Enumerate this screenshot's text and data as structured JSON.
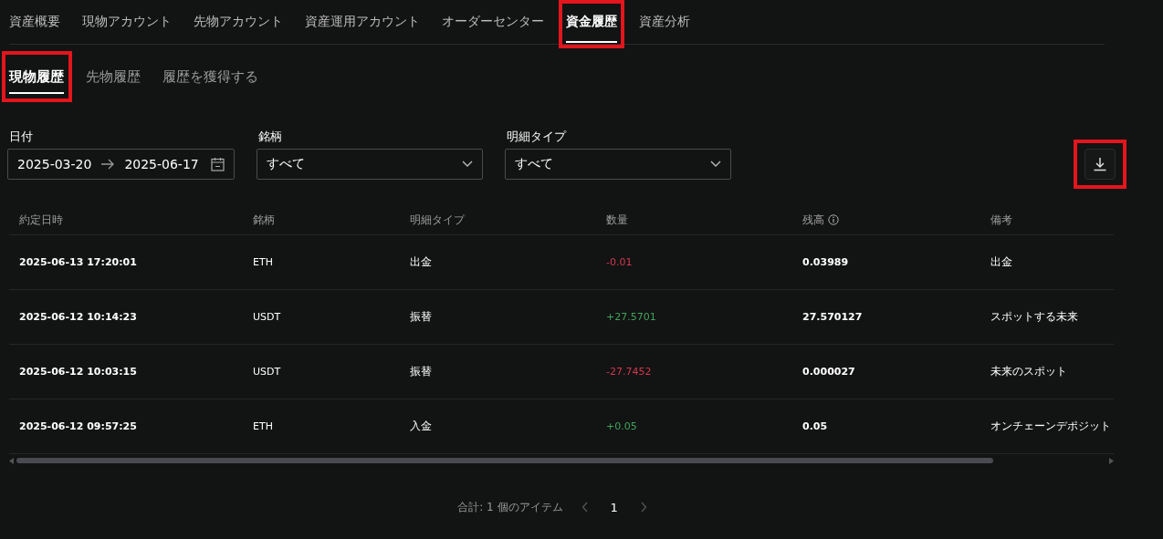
{
  "tabs": [
    {
      "label": "資産概要",
      "selected": false,
      "highlighted": false
    },
    {
      "label": "現物アカウント",
      "selected": false,
      "highlighted": false
    },
    {
      "label": "先物アカウント",
      "selected": false,
      "highlighted": false
    },
    {
      "label": "資産運用アカウント",
      "selected": false,
      "highlighted": false
    },
    {
      "label": "オーダーセンター",
      "selected": false,
      "highlighted": false
    },
    {
      "label": "資金履歴",
      "selected": true,
      "highlighted": true
    },
    {
      "label": "資産分析",
      "selected": false,
      "highlighted": false
    }
  ],
  "subtabs": [
    {
      "label": "現物履歴",
      "selected": true,
      "highlighted": true
    },
    {
      "label": "先物履歴",
      "selected": false,
      "highlighted": false
    },
    {
      "label": "履歴を獲得する",
      "selected": false,
      "highlighted": false
    }
  ],
  "filters": {
    "date": {
      "label": "日付",
      "start": "2025-03-20",
      "end": "2025-06-17"
    },
    "symbol": {
      "label": "銘柄",
      "value": "すべて"
    },
    "type": {
      "label": "明細タイプ",
      "value": "すべて"
    },
    "download_highlighted": true
  },
  "table": {
    "columns": [
      "約定日時",
      "銘柄",
      "明細タイプ",
      "数量",
      "残高",
      "備考"
    ],
    "rows": [
      {
        "time": "2025-06-13 17:20:01",
        "symbol": "ETH",
        "type": "出金",
        "amount": "-0.01",
        "kind": "debit",
        "balance": "0.03989",
        "note": "出金"
      },
      {
        "time": "2025-06-12 10:14:23",
        "symbol": "USDT",
        "type": "振替",
        "amount": "+27.5701",
        "kind": "credit",
        "balance": "27.570127",
        "note": "スポットする未来"
      },
      {
        "time": "2025-06-12 10:03:15",
        "symbol": "USDT",
        "type": "振替",
        "amount": "-27.7452",
        "kind": "debit",
        "balance": "0.000027",
        "note": "未来のスポット"
      },
      {
        "time": "2025-06-12 09:57:25",
        "symbol": "ETH",
        "type": "入金",
        "amount": "+0.05",
        "kind": "credit",
        "balance": "0.05",
        "note": "オンチェーンデポジット"
      }
    ]
  },
  "pagination": {
    "total": "合計: 1 個のアイテム",
    "pages": [
      {
        "label": "1",
        "selected": true
      }
    ]
  }
}
